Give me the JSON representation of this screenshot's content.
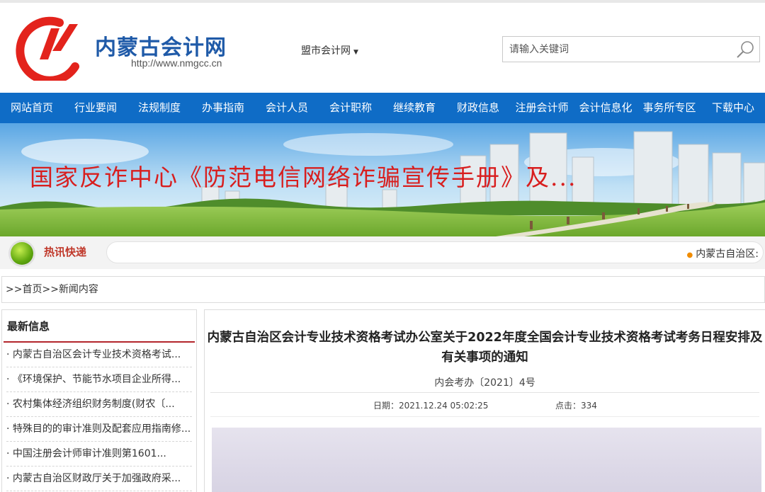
{
  "site": {
    "title": "内蒙古会计网",
    "url": "http://www.nmgcc.cn",
    "colors": {
      "nav_bg": "#0f6cc6",
      "logo_red": "#e3231c",
      "logo_blue": "#1f5aa8",
      "accent_red": "#b3262c"
    }
  },
  "header": {
    "city_select": "盟市会计网",
    "search_placeholder": "请输入关键词",
    "search_icon": "magnifier-icon"
  },
  "nav": {
    "items": [
      "网站首页",
      "行业要闻",
      "法规制度",
      "办事指南",
      "会计人员",
      "会计职称",
      "继续教育",
      "财政信息",
      "注册会计师",
      "会计信息化",
      "事务所专区",
      "下载中心"
    ]
  },
  "banner": {
    "text": "国家反诈中心《防范电信网络诈骗宣传手册》及..."
  },
  "hot_news": {
    "label": "热讯快递",
    "ticker": "内蒙古自治区:"
  },
  "breadcrumb": {
    "prefix": ">>",
    "home": "首页",
    "separator": ">>",
    "current": "新闻内容"
  },
  "sidebar": {
    "title": "最新信息",
    "items": [
      "· 内蒙古自治区会计专业技术资格考试...",
      "· 《环境保护、节能节水项目企业所得...",
      "· 农村集体经济组织财务制度(财农〔...",
      "· 特殊目的的审计准则及配套应用指南修...",
      "· 中国注册会计师审计准则第1601...",
      "· 内蒙古自治区财政厅关于加强政府采..."
    ]
  },
  "article": {
    "title": "内蒙古自治区会计专业技术资格考试办公室关于2022年度全国会计专业技术资格考试考务日程安排及有关事项的通知",
    "doc_no": "内会考办〔2021〕4号",
    "date_label": "日期：2021.12.24 05:02:25",
    "clicks_label": "点击：334"
  }
}
